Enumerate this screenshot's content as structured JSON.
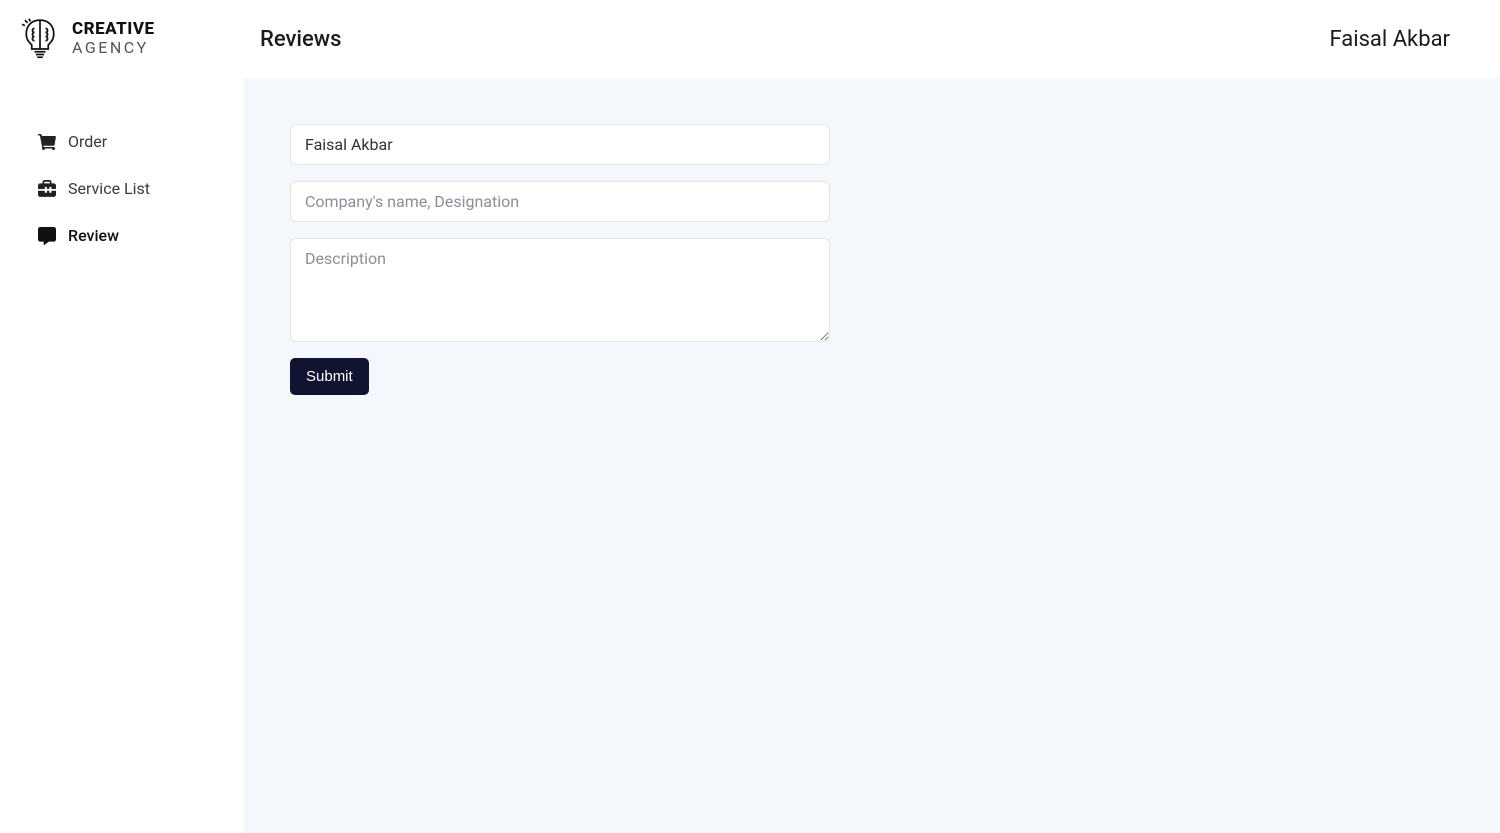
{
  "logo": {
    "line1": "CREATIVE",
    "line2": "AGENCY"
  },
  "sidebar": {
    "items": [
      {
        "label": "Order",
        "icon": "cart-icon",
        "active": false
      },
      {
        "label": "Service List",
        "icon": "toolbox-icon",
        "active": false
      },
      {
        "label": "Review",
        "icon": "chat-icon",
        "active": true
      }
    ]
  },
  "header": {
    "title": "Reviews",
    "user_name": "Faisal Akbar"
  },
  "form": {
    "name_value": "Faisal Akbar",
    "company_placeholder": "Company's name, Designation",
    "description_placeholder": "Description",
    "submit_label": "Submit"
  }
}
